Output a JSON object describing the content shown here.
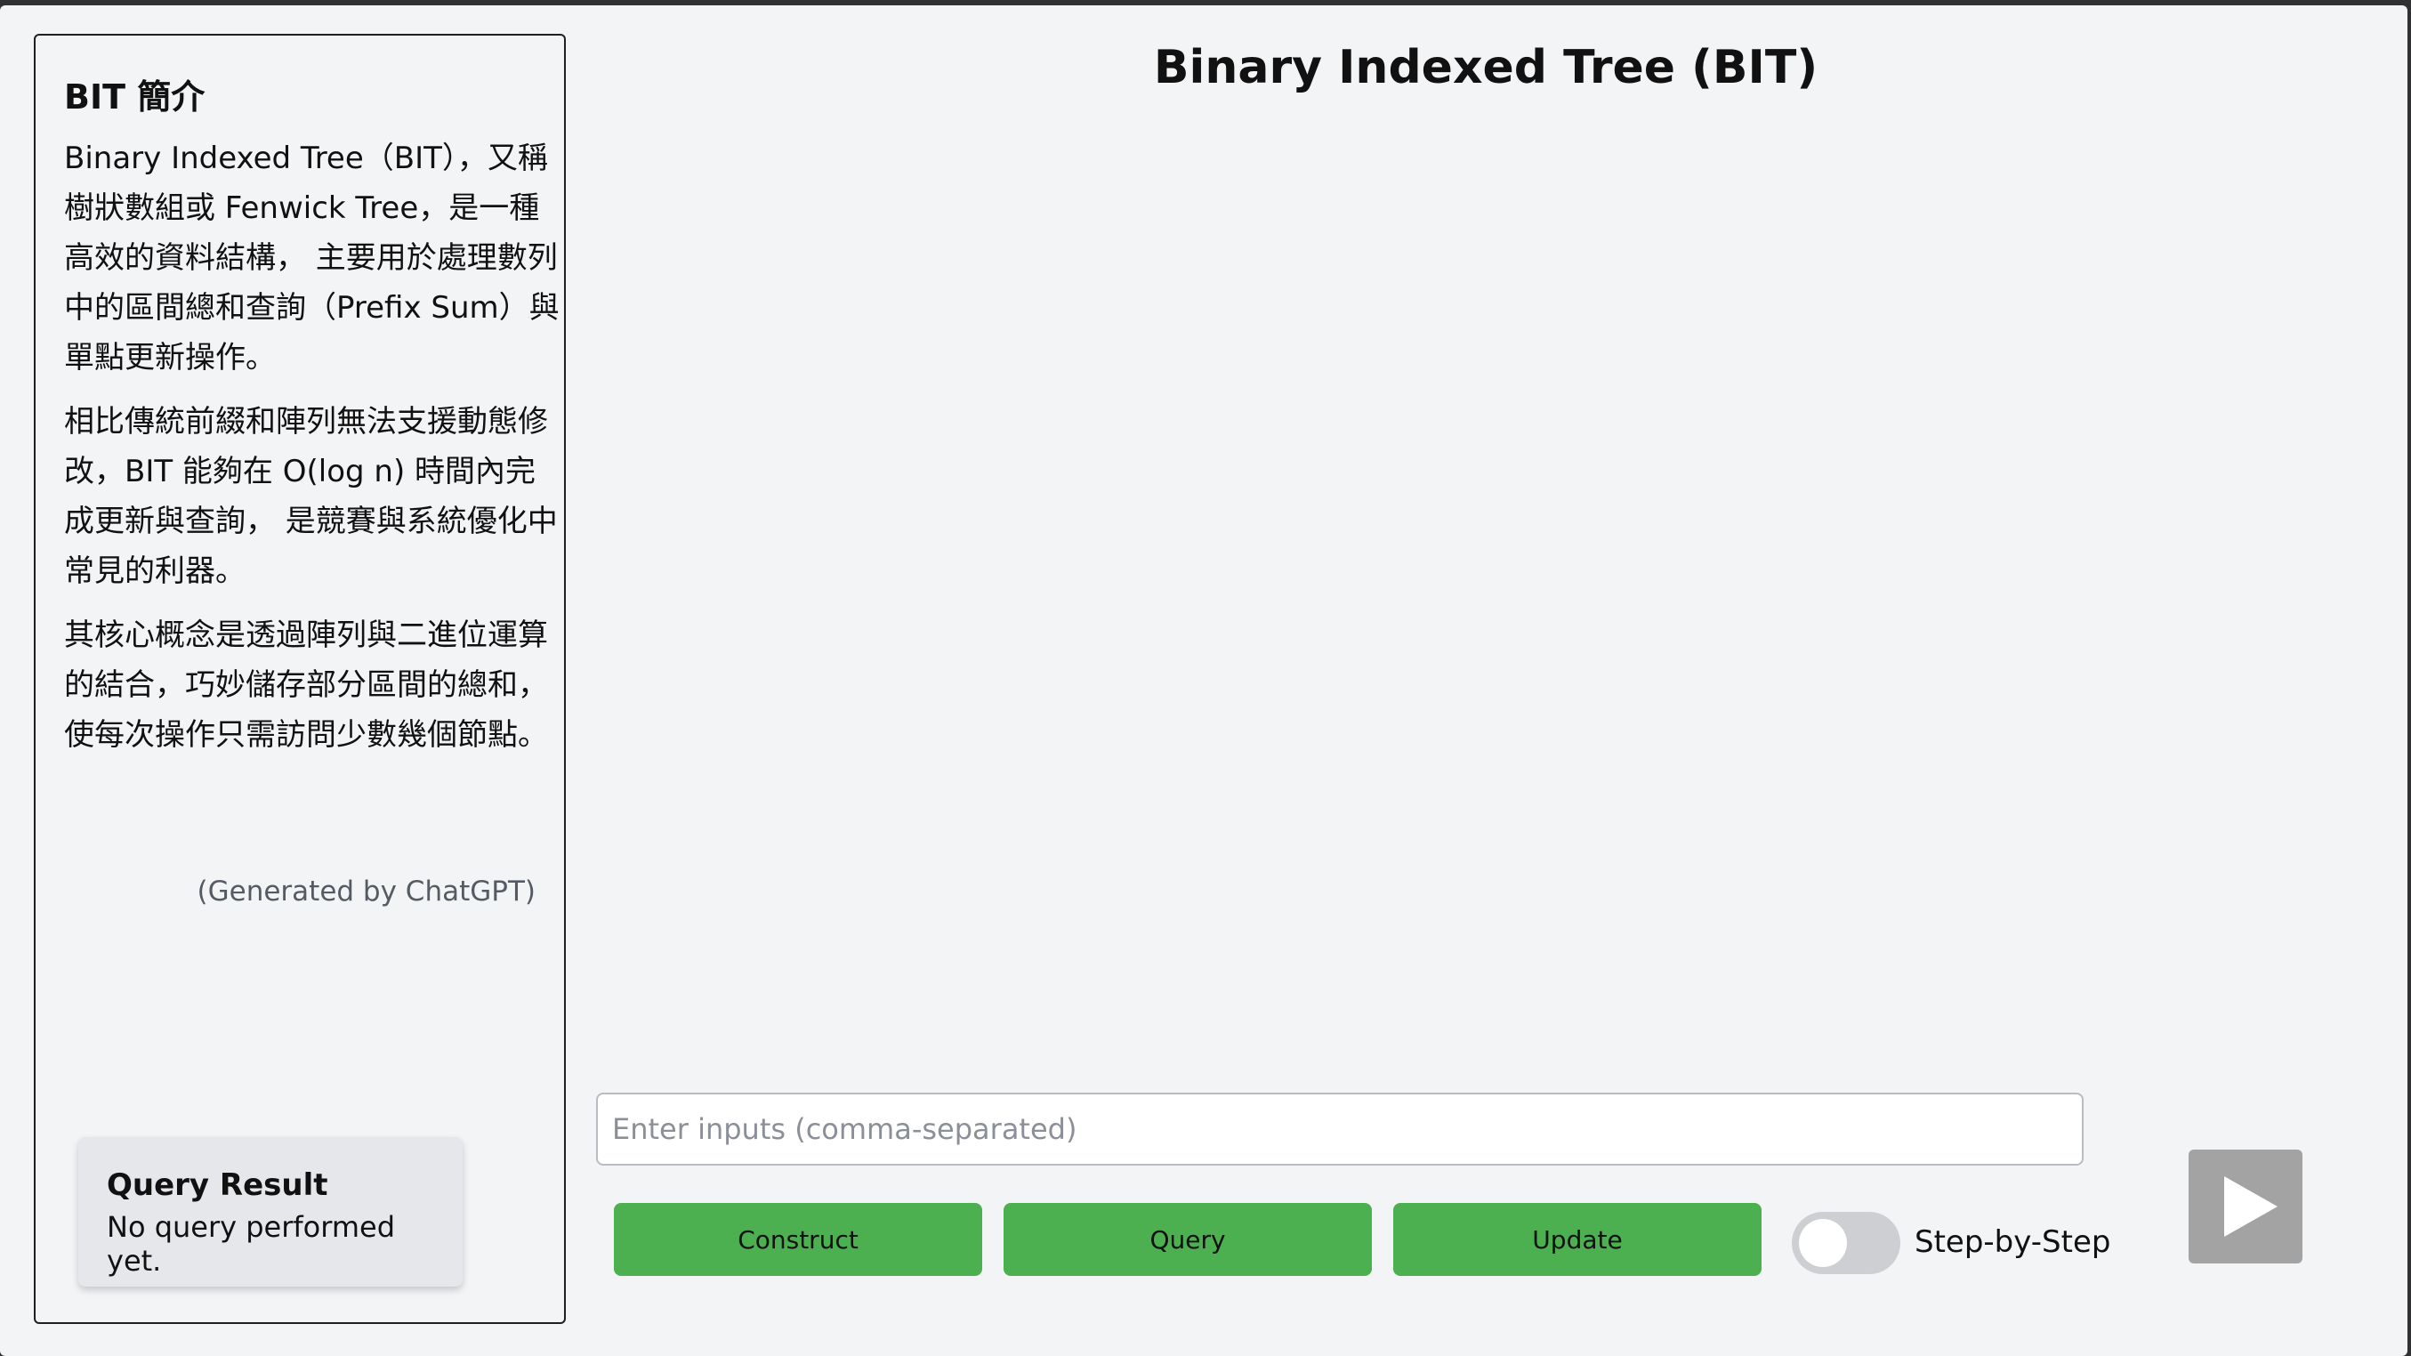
{
  "sidebar": {
    "intro_title": "BIT 簡介",
    "paragraphs": [
      "Binary Indexed Tree（BIT），又稱樹狀數組或 Fenwick Tree，是一種高效的資料結構， 主要用於處理數列中的區間總和查詢（Prefix Sum）與單點更新操作。",
      "相比傳統前綴和陣列無法支援動態修改，BIT 能夠在 O(log n) 時間內完成更新與查詢， 是競賽與系統優化中常見的利器。",
      "其核心概念是透過陣列與二進位運算的結合，巧妙儲存部分區間的總和， 使每次操作只需訪問少數幾個節點。"
    ],
    "credit": "(Generated by ChatGPT)",
    "query_result": {
      "title": "Query Result",
      "text": "No query performed yet."
    }
  },
  "main": {
    "title": "Binary Indexed Tree (BIT)",
    "input": {
      "value": "",
      "placeholder": "Enter inputs (comma-separated)"
    },
    "buttons": {
      "construct": "Construct",
      "query": "Query",
      "update": "Update"
    },
    "toggle": {
      "label": "Step-by-Step",
      "on": false
    },
    "play_icon": "play-icon"
  },
  "colors": {
    "button_green": "#4caf50",
    "background": "#f3f4f6",
    "play_button": "#a3a3a3"
  }
}
